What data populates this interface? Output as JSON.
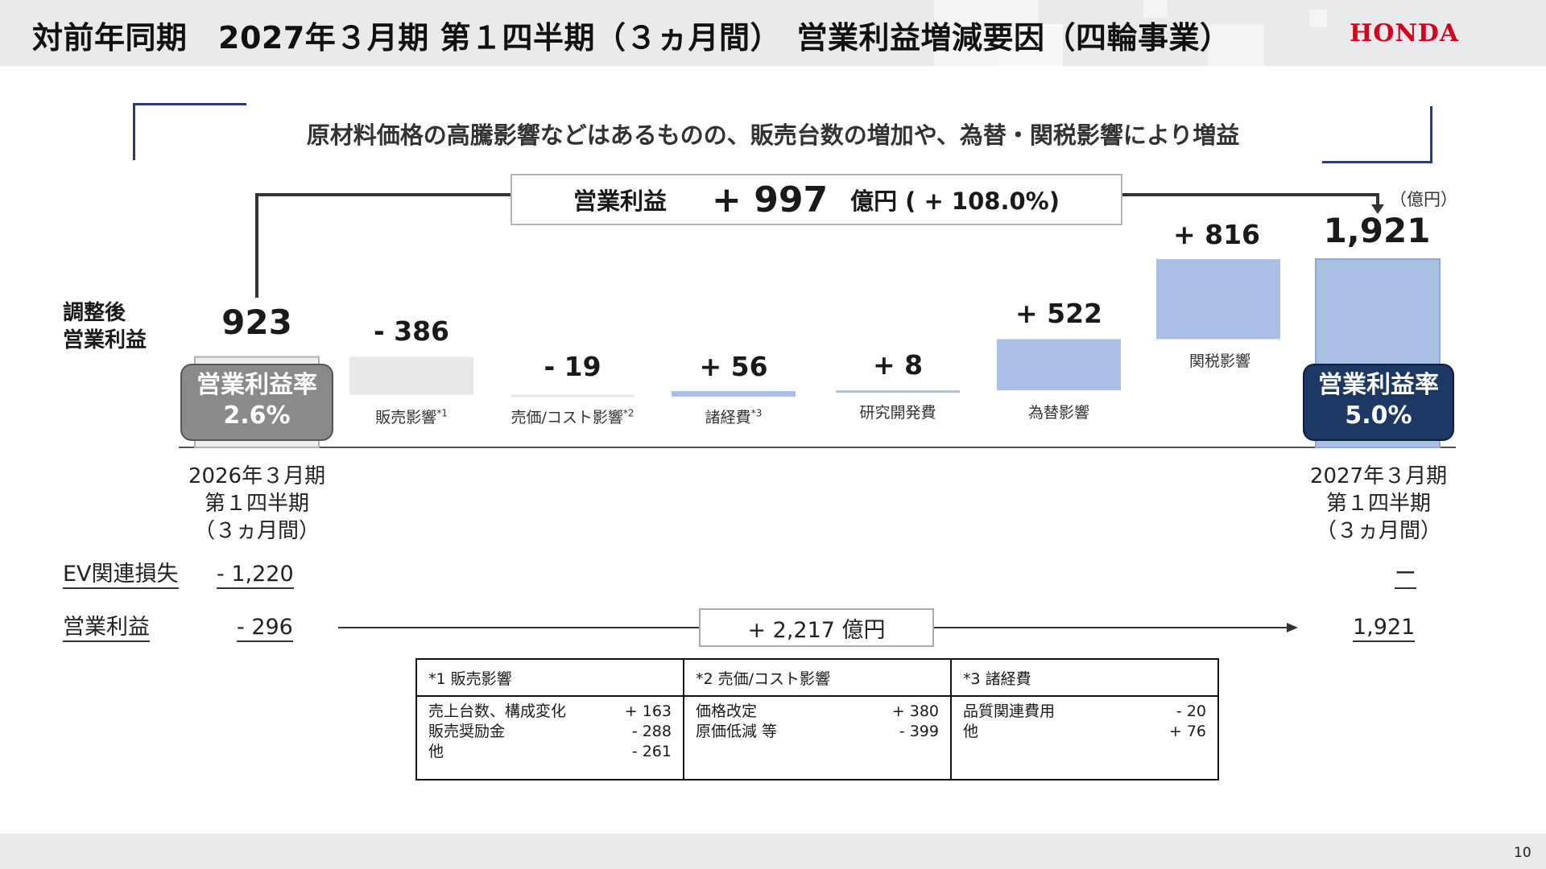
{
  "header": {
    "title": "対前年同期　2027年３月期 第１四半期（３ヵ月間）　営業利益増減要因（四輪事業）",
    "logo": "HONDA",
    "logo_color": "#d7001c"
  },
  "headline": "原材料価格の高騰影響などはあるものの、販売台数の増加や、為替・関税影響により増益",
  "total_change": {
    "label": "営業利益",
    "value": "+ 997",
    "unit": "億円 ( + 108.0%)"
  },
  "unit_label": "（億円）",
  "side_label_line1": "調整後",
  "side_label_line2": "営業利益",
  "chart_data": {
    "type": "bar",
    "subtype": "waterfall",
    "ylim": [
      0,
      2000
    ],
    "start": {
      "label": "923",
      "value": 923
    },
    "end": {
      "label": "1,921",
      "value": 1921
    },
    "steps": [
      {
        "name": "販売影響",
        "note": "*1",
        "delta": -386,
        "label": "- 386",
        "color": "#e8e8e8"
      },
      {
        "name": "売価/コスト影響",
        "note": "*2",
        "delta": -19,
        "label": "- 19",
        "color": "#e8e8e8"
      },
      {
        "name": "諸経費",
        "note": "*3",
        "delta": 56,
        "label": "+ 56",
        "color": "#a9bfe6"
      },
      {
        "name": "研究開発費",
        "note": "",
        "delta": 8,
        "label": "+ 8",
        "color": "#a9bfe6"
      },
      {
        "name": "為替影響",
        "note": "",
        "delta": 522,
        "label": "+ 522",
        "color": "#a9bfe6"
      },
      {
        "name": "関税影響",
        "note": "",
        "delta": 816,
        "label": "+ 816",
        "color": "#a9bfe6"
      }
    ],
    "start_color": "#eeeeee",
    "end_color": "#a9bfe6"
  },
  "badges": {
    "prev": {
      "label": "営業利益率",
      "value": "2.6%",
      "color": "#8a8a8a"
    },
    "curr": {
      "label": "営業利益率",
      "value": "5.0%",
      "color": "#1d3864"
    }
  },
  "periods": {
    "prev": [
      "2026年３月期",
      "第１四半期",
      "（３ヵ月間）"
    ],
    "curr": [
      "2027年３月期",
      "第１四半期",
      "（３ヵ月間）"
    ]
  },
  "ev_row": {
    "label": "EV関連損失",
    "prev": "- 1,220",
    "curr": "ー"
  },
  "op_row": {
    "label": "営業利益",
    "prev": "- 296",
    "curr": "1,921",
    "change": "+ 2,217 億円"
  },
  "footnotes": [
    {
      "title": "*1 販売影響",
      "rows": [
        {
          "item": "売上台数、構成変化",
          "value": "+ 163"
        },
        {
          "item": "販売奨励金",
          "value": "- 288"
        },
        {
          "item": "他",
          "value": "- 261"
        }
      ]
    },
    {
      "title": "*2 売価/コスト影響",
      "rows": [
        {
          "item": "価格改定",
          "value": "+ 380"
        },
        {
          "item": "原価低減 等",
          "value": "- 399"
        }
      ]
    },
    {
      "title": "*3 諸経費",
      "rows": [
        {
          "item": "品質関連費用",
          "value": "- 20"
        },
        {
          "item": "他",
          "value": "+ 76"
        }
      ]
    }
  ],
  "page_number": "10"
}
